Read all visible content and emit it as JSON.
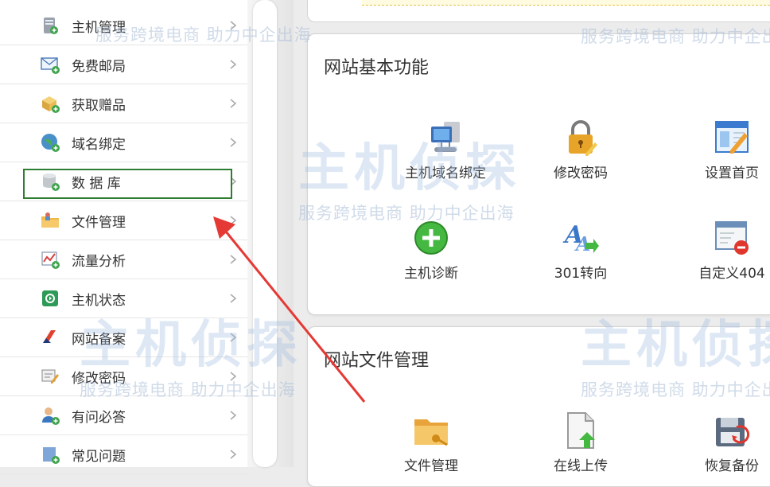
{
  "sidebar": {
    "items": [
      {
        "label": "主机管理",
        "icon": "server-icon"
      },
      {
        "label": "免费邮局",
        "icon": "mail-icon"
      },
      {
        "label": "获取赠品",
        "icon": "gift-box-icon"
      },
      {
        "label": "域名绑定",
        "icon": "globe-icon"
      },
      {
        "label": "数 据 库",
        "icon": "database-icon"
      },
      {
        "label": "文件管理",
        "icon": "folder-icon"
      },
      {
        "label": "流量分析",
        "icon": "traffic-chart-icon"
      },
      {
        "label": "主机状态",
        "icon": "status-icon"
      },
      {
        "label": "网站备案",
        "icon": "record-icon"
      },
      {
        "label": "修改密码",
        "icon": "password-icon"
      },
      {
        "label": "有问必答",
        "icon": "user-question-icon"
      },
      {
        "label": "常见问题",
        "icon": "faq-icon"
      }
    ]
  },
  "panels": {
    "basic": {
      "title": "网站基本功能",
      "items": [
        {
          "label": "主机域名绑定",
          "icon": "network-computer-icon"
        },
        {
          "label": "修改密码",
          "icon": "lock-icon"
        },
        {
          "label": "设置首页",
          "icon": "set-homepage-icon"
        },
        {
          "label": "主机诊断",
          "icon": "plus-circle-icon"
        },
        {
          "label": "301转向",
          "icon": "redirect-icon"
        },
        {
          "label": "自定义404",
          "icon": "custom-404-icon"
        }
      ]
    },
    "files": {
      "title": "网站文件管理",
      "items": [
        {
          "label": "文件管理",
          "icon": "folder-key-icon"
        },
        {
          "label": "在线上传",
          "icon": "upload-icon"
        },
        {
          "label": "恢复备份",
          "icon": "restore-backup-icon"
        }
      ]
    }
  },
  "watermark": {
    "brand": "主机侦探",
    "slogan": "服务跨境电商 助力中企出海"
  },
  "colors": {
    "highlight": "#2e7d32",
    "arrow": "#e53935"
  }
}
